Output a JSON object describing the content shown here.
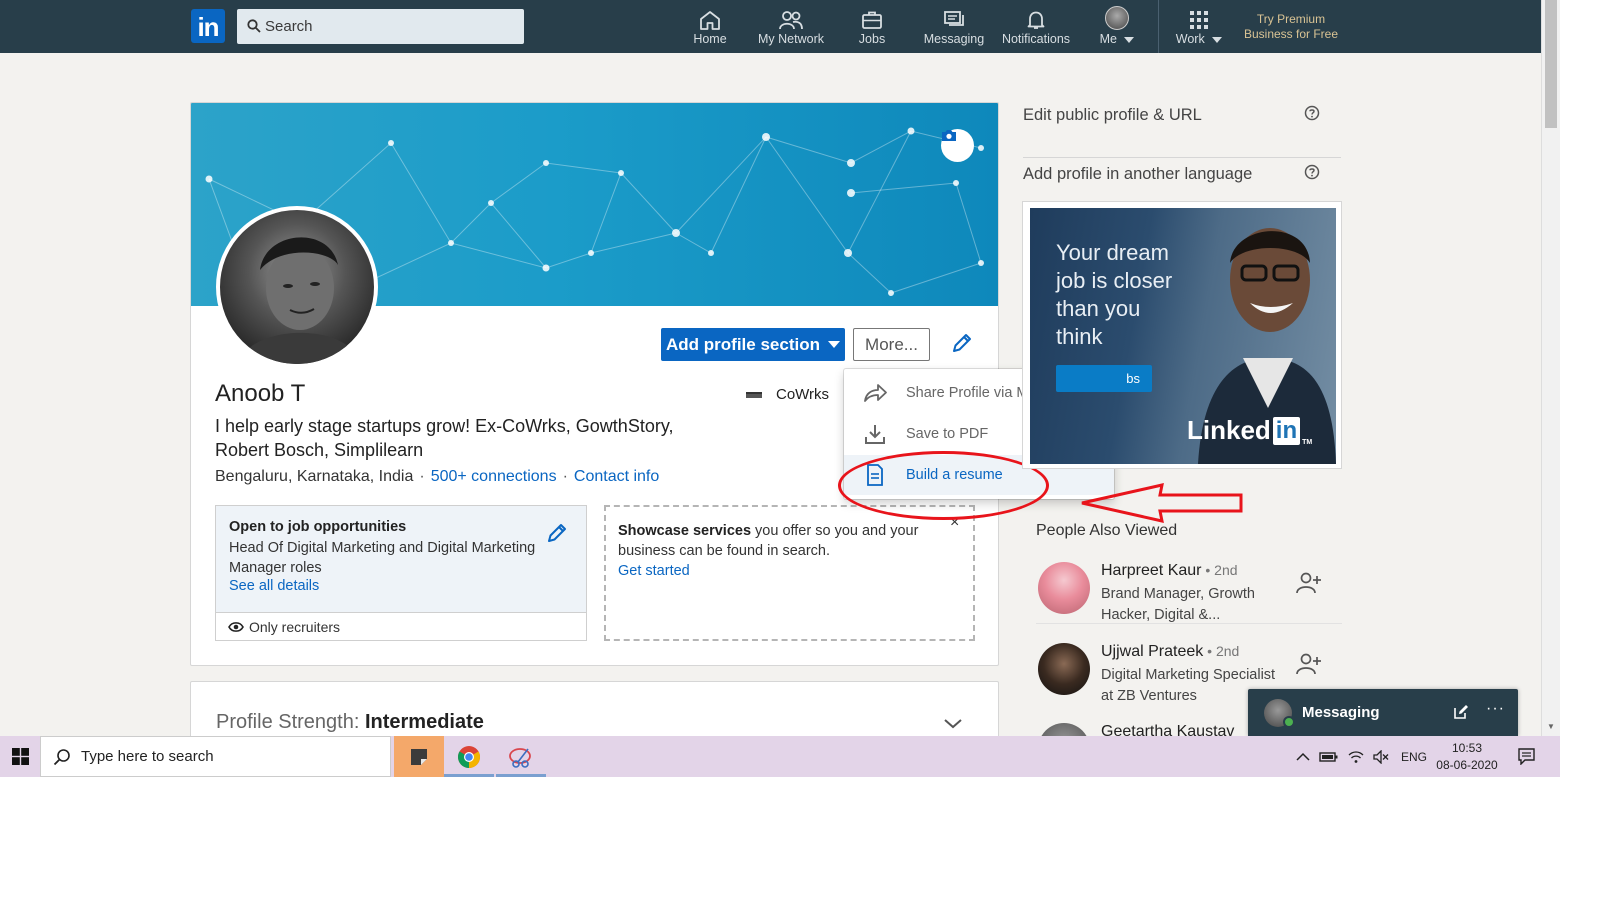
{
  "navbar": {
    "logo": "in",
    "search_placeholder": "Search",
    "items": [
      {
        "label": "Home",
        "icon": "home-icon"
      },
      {
        "label": "My Network",
        "icon": "network-icon"
      },
      {
        "label": "Jobs",
        "icon": "briefcase-icon"
      },
      {
        "label": "Messaging",
        "icon": "messaging-icon"
      },
      {
        "label": "Notifications",
        "icon": "bell-icon"
      },
      {
        "label": "Me",
        "icon": "avatar-icon"
      },
      {
        "label": "Work",
        "icon": "grid-icon"
      }
    ],
    "premium_line1": "Try Premium",
    "premium_line2": "Business for Free"
  },
  "profile": {
    "name": "Anoob T",
    "company": "CoWrks",
    "headline": "I help early stage startups grow! Ex-CoWrks, GowthStory, Robert Bosch, Simplilearn",
    "location": "Bengaluru, Karnataka, India",
    "connections": "500+ connections",
    "contact": "Contact info",
    "add_section_label": "Add profile section",
    "more_label": "More..."
  },
  "more_menu": {
    "items": [
      {
        "label": "Share Profile via Message",
        "icon": "share-arrow-icon"
      },
      {
        "label": "Save to PDF",
        "icon": "download-icon"
      },
      {
        "label": "Build a resume",
        "icon": "document-icon"
      }
    ],
    "highlighted": "Build a resume"
  },
  "job_card": {
    "title": "Open to job opportunities",
    "description": "Head Of Digital Marketing and Digital Marketing Manager roles",
    "link": "See all details",
    "visibility": "Only recruiters"
  },
  "services_card": {
    "bold": "Showcase services",
    "text": " you offer so you and your business can be found in search.",
    "link": "Get started",
    "close": "×"
  },
  "strength": {
    "label": "Profile Strength: ",
    "value": "Intermediate"
  },
  "rail": {
    "edit_url": "Edit public profile & URL",
    "another_language": "Add profile in another language",
    "ad_text": "Your dream job is closer than you think",
    "ad_button": "bs",
    "ad_brand_word": "Linked",
    "ad_brand_in": "in",
    "ad_brand_tm": "TM",
    "people_title": "People Also Viewed",
    "people": [
      {
        "name": "Harpreet Kaur",
        "degree": " • 2nd",
        "desc": "Brand Manager, Growth Hacker, Digital &...",
        "avatar_color": "#e98c9b"
      },
      {
        "name": "Ujjwal Prateek",
        "degree": " • 2nd",
        "desc": "Digital Marketing Specialist at ZB Ventures",
        "avatar_color": "#2a2a2a"
      },
      {
        "name": "Geetartha Kaustav",
        "degree": "",
        "desc": "",
        "avatar_color": "#6b6b6b"
      }
    ]
  },
  "messaging": {
    "label": "Messaging",
    "more": "···"
  },
  "taskbar": {
    "search_placeholder": "Type here to search",
    "language": "ENG",
    "time": "10:53",
    "date": "08-06-2020"
  },
  "colors": {
    "linkedin_blue": "#0a66c2",
    "navbar": "#283e4a",
    "annotation_red": "#e8141b",
    "premium_gold": "#d9c394"
  }
}
